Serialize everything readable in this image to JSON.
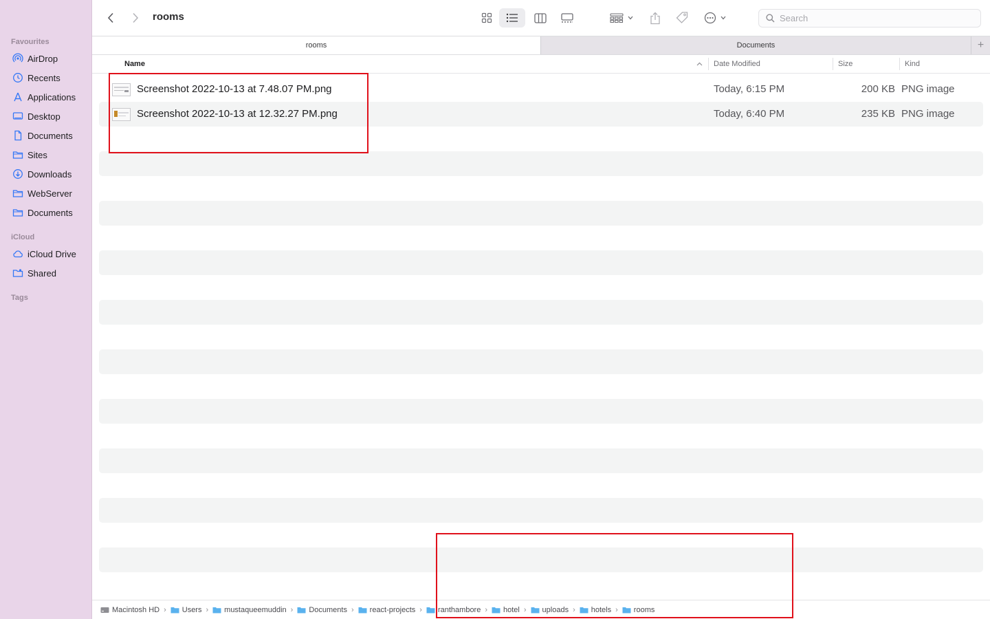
{
  "sidebar": {
    "favourites_heading": "Favourites",
    "favourites": [
      {
        "label": "AirDrop",
        "icon": "airdrop-icon"
      },
      {
        "label": "Recents",
        "icon": "clock-icon"
      },
      {
        "label": "Applications",
        "icon": "applications-icon"
      },
      {
        "label": "Desktop",
        "icon": "desktop-icon"
      },
      {
        "label": "Documents",
        "icon": "document-icon"
      },
      {
        "label": "Sites",
        "icon": "folder-icon"
      },
      {
        "label": "Downloads",
        "icon": "download-icon"
      },
      {
        "label": "WebServer",
        "icon": "folder-icon"
      },
      {
        "label": "Documents",
        "icon": "folder-icon"
      }
    ],
    "icloud_heading": "iCloud",
    "icloud": [
      {
        "label": "iCloud Drive",
        "icon": "cloud-icon"
      },
      {
        "label": "Shared",
        "icon": "shared-folder-icon"
      }
    ],
    "tags_heading": "Tags"
  },
  "toolbar": {
    "title": "rooms",
    "search_placeholder": "Search",
    "active_view": "list"
  },
  "tabs": [
    {
      "label": "rooms",
      "active": true
    },
    {
      "label": "Documents",
      "active": false
    }
  ],
  "columns": {
    "name": "Name",
    "date_modified": "Date Modified",
    "size": "Size",
    "kind": "Kind"
  },
  "files": [
    {
      "name": "Screenshot 2022-10-13 at 7.48.07 PM.png",
      "date": "Today, 6:15 PM",
      "size": "200 KB",
      "kind": "PNG image"
    },
    {
      "name": "Screenshot 2022-10-13 at 12.32.27 PM.png",
      "date": "Today, 6:40 PM",
      "size": "235 KB",
      "kind": "PNG image"
    }
  ],
  "path": [
    "Macintosh HD",
    "Users",
    "mustaqueemuddin",
    "Documents",
    "react-projects",
    "ranthambore",
    "hotel",
    "uploads",
    "hotels",
    "rooms"
  ],
  "colors": {
    "sidebar_bg": "#e9d5e9",
    "accent": "#3478f6",
    "annotation": "#e0101a"
  }
}
